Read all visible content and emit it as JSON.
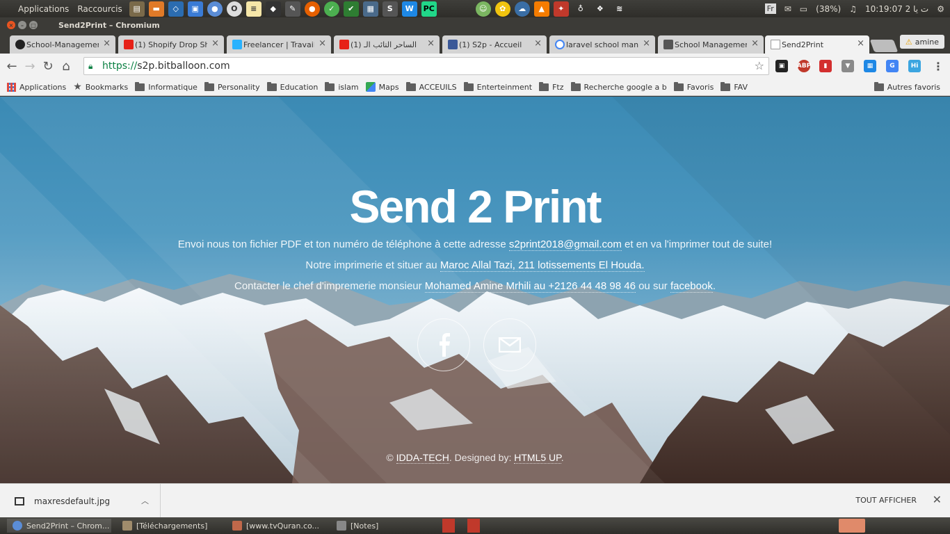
{
  "panel": {
    "menus": [
      "Applications",
      "Raccourcis"
    ],
    "keyboard": "Fr",
    "battery": "(38%)",
    "clock": "10:19:07 2 ت يا",
    "user": "amine"
  },
  "window": {
    "title": "Send2Print – Chromium"
  },
  "tabs": [
    {
      "label": "School-Management",
      "icon": "github-icon",
      "color": "#222222"
    },
    {
      "label": "(1) Shopify Drop Sh",
      "icon": "youtube-icon",
      "color": "#e62117"
    },
    {
      "label": "Freelancer | Travail",
      "icon": "freelancer-icon",
      "color": "#29b2fe"
    },
    {
      "label": "(1) الساحر التائب الـ",
      "icon": "youtube-icon",
      "color": "#e62117"
    },
    {
      "label": "(1) S2p - Accueil",
      "icon": "facebook-icon",
      "color": "#3b5998"
    },
    {
      "label": "laravel school mana",
      "icon": "google-icon",
      "color": "#4285f4"
    },
    {
      "label": "School Management",
      "icon": "page-icon",
      "color": "#555555"
    },
    {
      "label": "Send2Print",
      "icon": "page-icon",
      "color": "#999999",
      "active": true
    }
  ],
  "toolbar": {
    "url_scheme": "https://",
    "url_host": "s2p.bitballoon.com"
  },
  "bookmarks": [
    {
      "label": "Applications",
      "icon": "apps-grid-icon"
    },
    {
      "label": "Bookmarks",
      "icon": "star-icon"
    },
    {
      "label": "Informatique",
      "icon": "folder-icon"
    },
    {
      "label": "Personality",
      "icon": "folder-icon"
    },
    {
      "label": "Education",
      "icon": "folder-icon"
    },
    {
      "label": "islam",
      "icon": "folder-icon"
    },
    {
      "label": "Maps",
      "icon": "maps-icon"
    },
    {
      "label": "ACCEUILS",
      "icon": "folder-icon"
    },
    {
      "label": "Enterteinment",
      "icon": "folder-icon"
    },
    {
      "label": "Ftz",
      "icon": "folder-icon"
    },
    {
      "label": "Recherche google a b",
      "icon": "folder-icon"
    },
    {
      "label": "Favoris",
      "icon": "folder-icon"
    },
    {
      "label": "FAV",
      "icon": "folder-icon"
    }
  ],
  "bookmarks_other": "Autres favoris",
  "hero": {
    "title": "Send 2 Print",
    "line1_pre": "Envoi nous ton fichier PDF et ton numéro de téléphone à cette adresse ",
    "line1_link": "s2print2018@gmail.com",
    "line1_post": " et en va l'imprimer tout de suite!",
    "line2_pre": "Notre imprimerie et situer au ",
    "line2_link": "Maroc Allal Tazi, 211 lotissements El Houda.",
    "line3_pre": "Contacter le chef d'impremerie monsieur ",
    "line3_link1": "Mohamed Amine Mrhili au +2126 44 48 98 46",
    "line3_mid": " ou sur ",
    "line3_link2": "facebook",
    "line3_post": "."
  },
  "footer": {
    "pre": "© ",
    "link1": "IDDA-TECH",
    "mid": ". Designed by: ",
    "link2": "HTML5 UP",
    "post": "."
  },
  "downloads": {
    "file": "maxresdefault.jpg",
    "show_all": "TOUT AFFICHER"
  },
  "taskbar": [
    {
      "label": "Send2Print – Chrom...",
      "icon": "chromium-icon",
      "active": true
    },
    {
      "label": "[Téléchargements]",
      "icon": "file-manager-icon"
    },
    {
      "label": "[www.tvQuran.co...",
      "icon": "download-icon"
    },
    {
      "label": "[Notes]",
      "icon": "notes-icon"
    }
  ]
}
